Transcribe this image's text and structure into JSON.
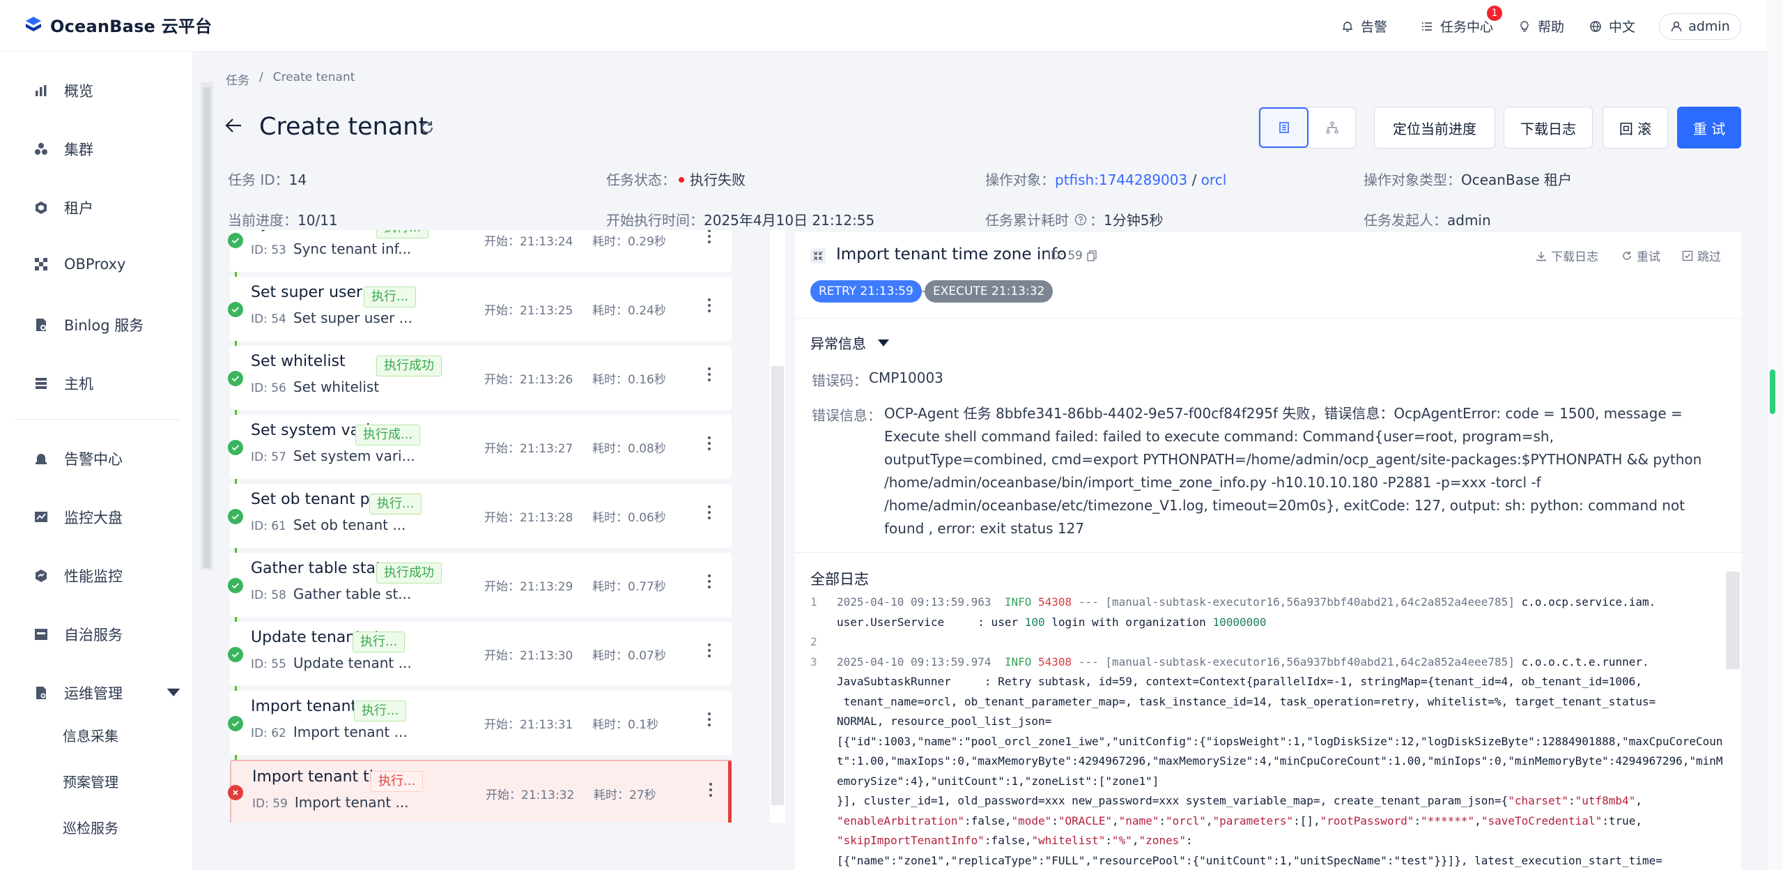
{
  "app": {
    "name": "OceanBase 云平台"
  },
  "topbar": {
    "alerts_label": "告警",
    "tasks_label": "任务中心",
    "tasks_badge": "1",
    "help_label": "帮助",
    "lang_label": "中文",
    "user_label": "admin"
  },
  "sidebar": {
    "items": [
      {
        "label": "概览",
        "icon": "bar-chart-icon"
      },
      {
        "label": "集群",
        "icon": "cluster-icon"
      },
      {
        "label": "租户",
        "icon": "tenant-icon"
      },
      {
        "label": "OBProxy",
        "icon": "proxy-icon"
      },
      {
        "label": "Binlog 服务",
        "icon": "binlog-icon"
      },
      {
        "label": "主机",
        "icon": "host-icon"
      },
      {
        "label": "告警中心",
        "icon": "alarm-icon"
      },
      {
        "label": "监控大盘",
        "icon": "monitor-icon"
      },
      {
        "label": "性能监控",
        "icon": "performance-icon"
      },
      {
        "label": "自治服务",
        "icon": "autonomy-icon"
      },
      {
        "label": "运维管理",
        "icon": "ops-icon"
      }
    ],
    "subitems": [
      {
        "label": "信息采集"
      },
      {
        "label": "预案管理"
      },
      {
        "label": "巡检服务"
      }
    ]
  },
  "breadcrumb": {
    "parent": "任务",
    "sep": "/",
    "current": "Create tenant"
  },
  "page": {
    "title": "Create tenant"
  },
  "meta": {
    "task_id_label": "任务 ID：",
    "task_id": "14",
    "status_label": "任务状态：",
    "status": "执行失败",
    "target_label": "操作对象：",
    "target_cluster": "ptfish:1744289003",
    "target_sep": " / ",
    "target_tenant": "orcl",
    "target_type_label": "操作对象类型：",
    "target_type": "OceanBase 租户",
    "progress_label": "当前进度：",
    "progress": "10/11",
    "start_label": "开始执行时间：",
    "start": "2025年4月10日 21:12:55",
    "elapsed_label": "任务累计耗时",
    "elapsed_colon": "：",
    "elapsed": "1分钟5秒",
    "initiator_label": "任务发起人：",
    "initiator": "admin"
  },
  "actions": {
    "locate": "定位当前进度",
    "download_log": "下载日志",
    "rollback": "回 滚",
    "retry": "重 试"
  },
  "tasks": [
    {
      "title": "Sync tenant infor",
      "tag": "执行...",
      "tag_type": "ok",
      "id": "ID: 53",
      "sub": "Sync tenant inf...",
      "start": "开始：21:13:24",
      "dur": "耗时：0.29秒",
      "state": "success"
    },
    {
      "title": "Set super user pa...",
      "tag": "执行...",
      "tag_type": "ok",
      "id": "ID: 54",
      "sub": "Set super user ...",
      "start": "开始：21:13:25",
      "dur": "耗时：0.24秒",
      "state": "success"
    },
    {
      "title": "Set whitelist",
      "tag": "执行成功",
      "tag_type": "ok",
      "id": "ID: 56",
      "sub": "Set whitelist",
      "start": "开始：21:13:26",
      "dur": "耗时：0.16秒",
      "state": "success"
    },
    {
      "title": "Set system varia...",
      "tag": "执行成...",
      "tag_type": "ok",
      "id": "ID: 57",
      "sub": "Set system vari...",
      "start": "开始：21:13:27",
      "dur": "耗时：0.08秒",
      "state": "success"
    },
    {
      "title": "Set ob tenant par...",
      "tag": "执行...",
      "tag_type": "ok",
      "id": "ID: 61",
      "sub": "Set ob tenant ...",
      "start": "开始：21:13:28",
      "dur": "耗时：0.06秒",
      "state": "success"
    },
    {
      "title": "Gather table stats",
      "tag": "执行成功",
      "tag_type": "ok",
      "id": "ID: 58",
      "sub": "Gather table st...",
      "start": "开始：21:13:29",
      "dur": "耗时：0.77秒",
      "state": "success"
    },
    {
      "title": "Update tenant st...",
      "tag": "执行...",
      "tag_type": "ok",
      "id": "ID: 55",
      "sub": "Update tenant ...",
      "start": "开始：21:13:30",
      "dur": "耗时：0.07秒",
      "state": "success"
    },
    {
      "title": "Import tenant srs...",
      "tag": "执行...",
      "tag_type": "ok",
      "id": "ID: 62",
      "sub": "Import tenant ...",
      "start": "开始：21:13:31",
      "dur": "耗时：0.1秒",
      "state": "success"
    },
    {
      "title": "Import tenant tim...",
      "tag": "执行...",
      "tag_type": "bad",
      "id": "ID: 59",
      "sub": "Import tenant ...",
      "start": "开始：21:13:32",
      "dur": "耗时：27秒",
      "state": "failed"
    }
  ],
  "detail": {
    "title": "Import tenant time zone info",
    "id": "ID: 59",
    "download_log": "下载日志",
    "retry": "重试",
    "skip": "跳过",
    "pill_retry": "RETRY 21:13:59",
    "pill_execute": "EXECUTE 21:13:32",
    "exception_title": "异常信息",
    "error_code_label": "错误码：",
    "error_code": "CMP10003",
    "error_msg_label": "错误信息：",
    "error_msg": "OCP-Agent 任务 8bbfe341-86bb-4402-9e57-f00cf84f295f 失败，错误信息：OcpAgentError: code = 1500, message = Execute shell command failed: failed to execute command: Command{user=root, program=sh, outputType=combined, cmd=export PYTHONPATH=/home/admin/ocp_agent/site-packages:$PYTHONPATH && python /home/admin/oceanbase/bin/import_time_zone_info.py -h10.10.10.180 -P2881 -p=xxx -torcl -f /home/admin/oceanbase/etc/timezone_V1.log, timeout=20m0s}, exitCode: 127, output: sh: python: command not found , error: exit status 127",
    "log_title": "全部日志"
  },
  "log": {
    "l1_no": "1",
    "l1_ts": "2025-04-10 09:13:59.963",
    "l1_level": "INFO",
    "l1_pid": "54308",
    "l1_thread": "--- [manual-subtask-executor16,56a937bbf40abd21,64c2a852a4eee785]",
    "l1_a": "c.o.ocp.service.iam.\nuser.UserService     : user ",
    "l1_n1": "100",
    "l1_b": " login with organization ",
    "l1_n2": "10000000",
    "l2_no": "2",
    "l3_no": "3",
    "l3_ts": "2025-04-10 09:13:59.974",
    "l3_level": "INFO",
    "l3_pid": "54308",
    "l3_thread": "--- [manual-subtask-executor16,56a937bbf40abd21,64c2a852a4eee785]",
    "l3_a": "c.o.o.c.t.e.runner.\nJavaSubtaskRunner     : Retry subtask, id=59, context=Context{parallelIdx=-1, stringMap={tenant_id=4, ob_tenant_id=1006,\n tenant_name=orcl, ob_tenant_parameter_map=, task_instance_id=14, task_operation=retry, whitelist=%, target_tenant_status=\nNORMAL, resource_pool_list_json=\n[{\"id\":1003,\"name\":\"pool_orcl_zone1_iwe\",\"unitConfig\":{\"iopsWeight\":1,\"logDiskSize\":12,\"logDiskSizeByte\":12884901888,\"maxCpuCoreCount\":1.00,\"maxIops\":0,\"maxMemoryByte\":4294967296,\"maxMemorySize\":4,\"minCpuCoreCount\":1.00,\"minIops\":0,\"minMemoryByte\":4294967296,\"minMemorySize\":4},\"unitCount\":1,\"zoneList\":[\"zone1\"]\n}], cluster_id=1, old_password=xxx new_password=xxx system_variable_map=, create_tenant_param_json={",
    "l3_k1": "\"charset\"",
    "l3_b": ":",
    "l3_s1": "\"utf8mb4\"",
    "l3_c": ",\n",
    "l3_k2": "\"enableArbitration\"",
    "l3_d": ":false,",
    "l3_k3": "\"mode\"",
    "l3_e": ":",
    "l3_s2": "\"ORACLE\"",
    "l3_f": ",",
    "l3_k4": "\"name\"",
    "l3_g": ":",
    "l3_s3": "\"orcl\"",
    "l3_h": ",",
    "l3_k5": "\"parameters\"",
    "l3_i": ":[],",
    "l3_k6": "\"rootPassword\"",
    "l3_j": ":",
    "l3_s4": "\"******\"",
    "l3_k": ",",
    "l3_k7": "\"saveToCredential\"",
    "l3_l": ":true,\n",
    "l3_k8": "\"skipImportTenantInfo\"",
    "l3_m": ":false,",
    "l3_k9": "\"whitelist\"",
    "l3_n": ":",
    "l3_s5": "\"%\"",
    "l3_o": ",",
    "l3_k10": "\"zones\"",
    "l3_p": ":\n[{\"name\":\"zone1\",\"replicaType\":\"FULL\",\"resourcePool\":{\"unitCount\":1,\"unitSpecName\":\"test\"}}]}, latest_execution_start_time="
  },
  "colors": {
    "accent": "#2b6bff",
    "success": "#3ab55e",
    "danger": "#e23d3d"
  }
}
